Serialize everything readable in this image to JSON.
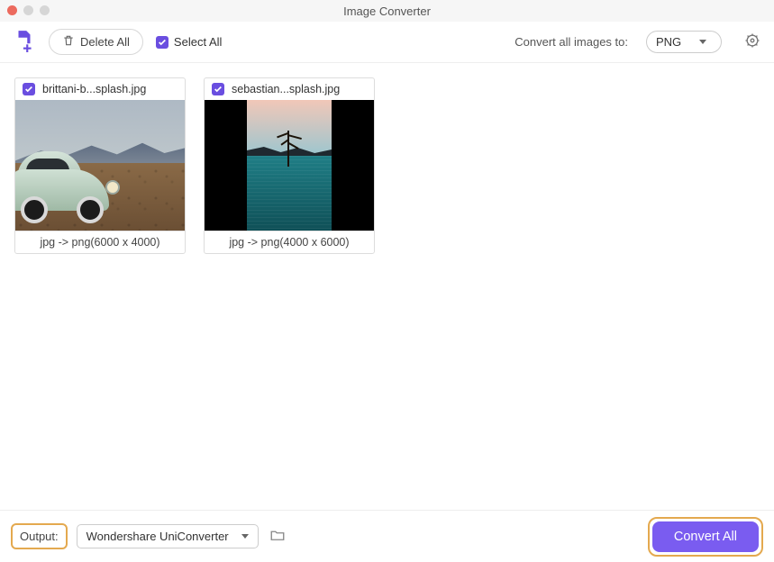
{
  "window": {
    "title": "Image Converter"
  },
  "toolbar": {
    "delete_all": "Delete All",
    "select_all": "Select All",
    "convert_label": "Convert all images to:",
    "format": "PNG"
  },
  "items": [
    {
      "filename": "brittani-b...splash.jpg",
      "footer": "jpg -> png(6000 x 4000)",
      "checked": true
    },
    {
      "filename": "sebastian...splash.jpg",
      "footer": "jpg -> png(4000 x 6000)",
      "checked": true
    }
  ],
  "footer": {
    "output_label": "Output:",
    "output_path": "Wondershare UniConverter",
    "convert_all": "Convert All"
  },
  "colors": {
    "accent": "#7a5cf0",
    "highlight": "#e4a94f"
  }
}
